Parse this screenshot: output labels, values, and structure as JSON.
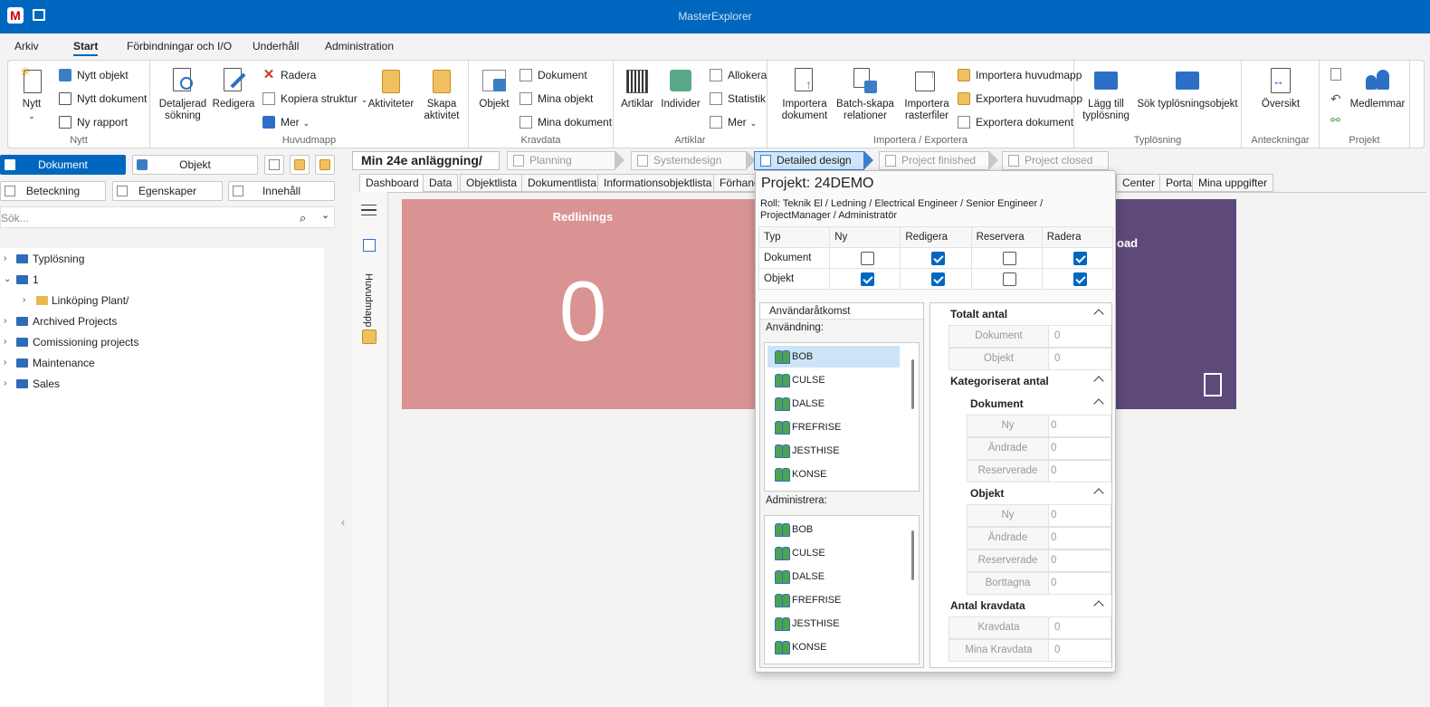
{
  "app": {
    "title": "MasterExplorer",
    "logo_letter": "M"
  },
  "menu": [
    "Arkiv",
    "Start",
    "Förbindningar och I/O",
    "Underhåll",
    "Administration"
  ],
  "ribbon": {
    "nytt": {
      "label": "Nytt",
      "big": "Nytt",
      "items": [
        "Nytt objekt",
        "Nytt dokument",
        "Ny rapport"
      ]
    },
    "huvudmapp": {
      "label": "Huvudmapp",
      "detaljerad": "Detaljerad\nsökning",
      "redigera": "Redigera",
      "items": [
        "Radera",
        "Kopiera struktur",
        "Mer"
      ],
      "aktiviteter": "Aktiviteter",
      "skapa": "Skapa\naktivitet"
    },
    "kravdata": {
      "label": "Kravdata",
      "objekt": "Objekt",
      "items": [
        "Dokument",
        "Mina objekt",
        "Mina dokument"
      ]
    },
    "artiklar": {
      "label": "Artiklar",
      "artiklar": "Artiklar",
      "individer": "Individer",
      "items": [
        "Allokera",
        "Statistik",
        "Mer"
      ]
    },
    "importera": {
      "label": "Importera / Exportera",
      "imp_dok": "Importera\ndokument",
      "batch": "Batch-skapa\nrelationer",
      "imp_rast": "Importera\nrasterfiler",
      "items": [
        "Importera huvudmapp",
        "Exportera huvudmapp",
        "Exportera dokument"
      ]
    },
    "typlosning": {
      "label": "Typlösning",
      "lagg": "Lägg till\ntyplösning",
      "sok": "Sök typlösningsobjekt"
    },
    "anteckningar": {
      "label": "Anteckningar",
      "oversikt": "Översikt"
    },
    "projekt": {
      "label": "Projekt",
      "medlemmar": "Medlemmar"
    }
  },
  "left": {
    "btn_dokument": "Dokument",
    "btn_objekt": "Objekt",
    "btn_beteckning": "Beteckning",
    "btn_egenskaper": "Egenskaper",
    "btn_innehall": "Innehåll",
    "search_placeholder": "Sök...",
    "tree": [
      "Typlösning",
      "1",
      "Linköping Plant/",
      "Archived Projects",
      "Comissioning projects",
      "Maintenance",
      "Sales"
    ]
  },
  "breadcrumb": "Min 24e anläggning/",
  "steps": [
    "Planning",
    "Systemdesign",
    "Detailed design",
    "Project finished",
    "Project closed"
  ],
  "tabs": [
    "Dashboard",
    "Data",
    "Objektlista",
    "Dokumentlista",
    "Informationsobjektlista",
    "Förhand",
    "Center",
    "Portal",
    "Mina uppgifter"
  ],
  "vstrip_label": "Huvudmapp",
  "tiles": {
    "redlinings_title": "Redlinings",
    "redlinings_value": "0",
    "tile2_title": "oad"
  },
  "popup": {
    "title": "Projekt: 24DEMO",
    "roll": "Roll: Teknik El / Ledning / Electrical Engineer / Senior Engineer / ProjectManager / Administratör",
    "perm_headers": [
      "Typ",
      "Ny",
      "Redigera",
      "Reservera",
      "Radera"
    ],
    "perm_rows": [
      {
        "typ": "Dokument",
        "ny": false,
        "redigera": true,
        "reservera": false,
        "radera": true
      },
      {
        "typ": "Objekt",
        "ny": true,
        "redigera": true,
        "reservera": false,
        "radera": true
      }
    ],
    "anvandaratkomst": "Användaråtkomst",
    "anvandning_label": "Användning:",
    "administrera_label": "Administrera:",
    "users": [
      "BOB",
      "CULSE",
      "DALSE",
      "FREFRISE",
      "JESTHISE",
      "KONSE"
    ],
    "counts": {
      "totalt": "Totalt antal",
      "dokument": "Dokument",
      "objekt": "Objekt",
      "kategoriserat": "Kategoriserat antal",
      "ny": "Ny",
      "andrade": "Ändrade",
      "reserverade": "Reserverade",
      "borttagna": "Borttagna",
      "antal_kravdata": "Antal kravdata",
      "kravdata": "Kravdata",
      "mina_kravdata": "Mina Kravdata",
      "zero": "0"
    }
  }
}
